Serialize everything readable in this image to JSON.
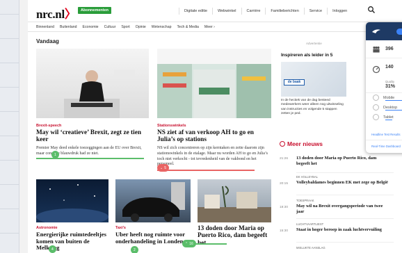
{
  "header": {
    "logo_text": "nrc.nl",
    "logo_bracket": "〉",
    "subscribe_label": "Abonnementen",
    "top_nav": [
      "Digitale editie",
      "Webwinkel",
      "Carrière",
      "Familieberichten",
      "Service",
      "Inloggen"
    ]
  },
  "nav": [
    "Binnenland",
    "Buitenland",
    "Economie",
    "Cultuur",
    "Sport",
    "Opinie",
    "Wetenschap",
    "Tech & Media",
    "Meer ›"
  ],
  "section_title": "Vandaag",
  "advertentie": "Advertentie",
  "articles": [
    {
      "kicker": "Brexit-speech",
      "headline": "May wil ‘creatieve’ Brexit, zegt ze tien keer",
      "body": "Premier May deed enkele toezeggingen aan de EU over Brexit, maar concrete blauwdruk had ze niet.",
      "badge": "1"
    },
    {
      "kicker": "Stationswinkels",
      "headline": "NS ziet af van verkoop AH to go en Julia’s op stations",
      "body": "NS wil zich concentreren op zijn kerntaken en zette daarom zijn stationswinkels in de etalage. Maar nu worden AH to go en Julia’s toch niet verkocht - tot tevredenheid van de vakbond en het personeel.",
      "badge": "5"
    },
    {
      "kicker": "Astronomie",
      "headline": "Energierijke ruimtedeeltjes komen van buiten de Melkweg",
      "badge": "4"
    },
    {
      "kicker": "Taxi’s",
      "headline": "Uber heeft nog ruimte voor onderhandeling in Londen",
      "badge": "2"
    },
    {
      "kicker": "",
      "headline": "13 doden door Maria op Puerto Rico, dam begeeft het",
      "badge": "16"
    }
  ],
  "sidebar_ad": {
    "title": "Inspireren als leider in 5",
    "logo": "de baak",
    "text": "In de hectiek van de dag besteed medewerkers weer alleen nog uitwisseling van instructies en volgende 5 stappen zetten je ped."
  },
  "meer_nieuws": {
    "title": "Meer nieuws",
    "items": [
      {
        "time": "21:26",
        "kicker": "",
        "headline": "13 doden door Maria op Puerto Rico, dam begeeft het"
      },
      {
        "time": "20:15",
        "kicker": "EK VOLLEYBAL",
        "headline": "Volleybaldames beginnen EK met zege op België"
      },
      {
        "time": "18:30",
        "kicker": "TOESPRAAK",
        "headline": "May wil na Brexit overgangsperiode van twee jaar"
      },
      {
        "time": "15:30",
        "kicker": "LUCHTVAARTLIEST",
        "headline": "Staat in hoger beroep in zaak luchtvervuiling"
      },
      {
        "time": "",
        "kicker": "MISLUKTE AANSLAG",
        "headline": ""
      }
    ]
  },
  "panel": {
    "stat1": "396",
    "stat2": "140",
    "quality_label": "Quality",
    "quality_value": "31%",
    "devices": [
      "Mobile",
      "Desktop",
      "Tablet"
    ],
    "link1": "Headline Test Results",
    "link2": "Real-Time Dashboard",
    "accent": "#3b82f6",
    "header_color": "#1e3a64"
  }
}
